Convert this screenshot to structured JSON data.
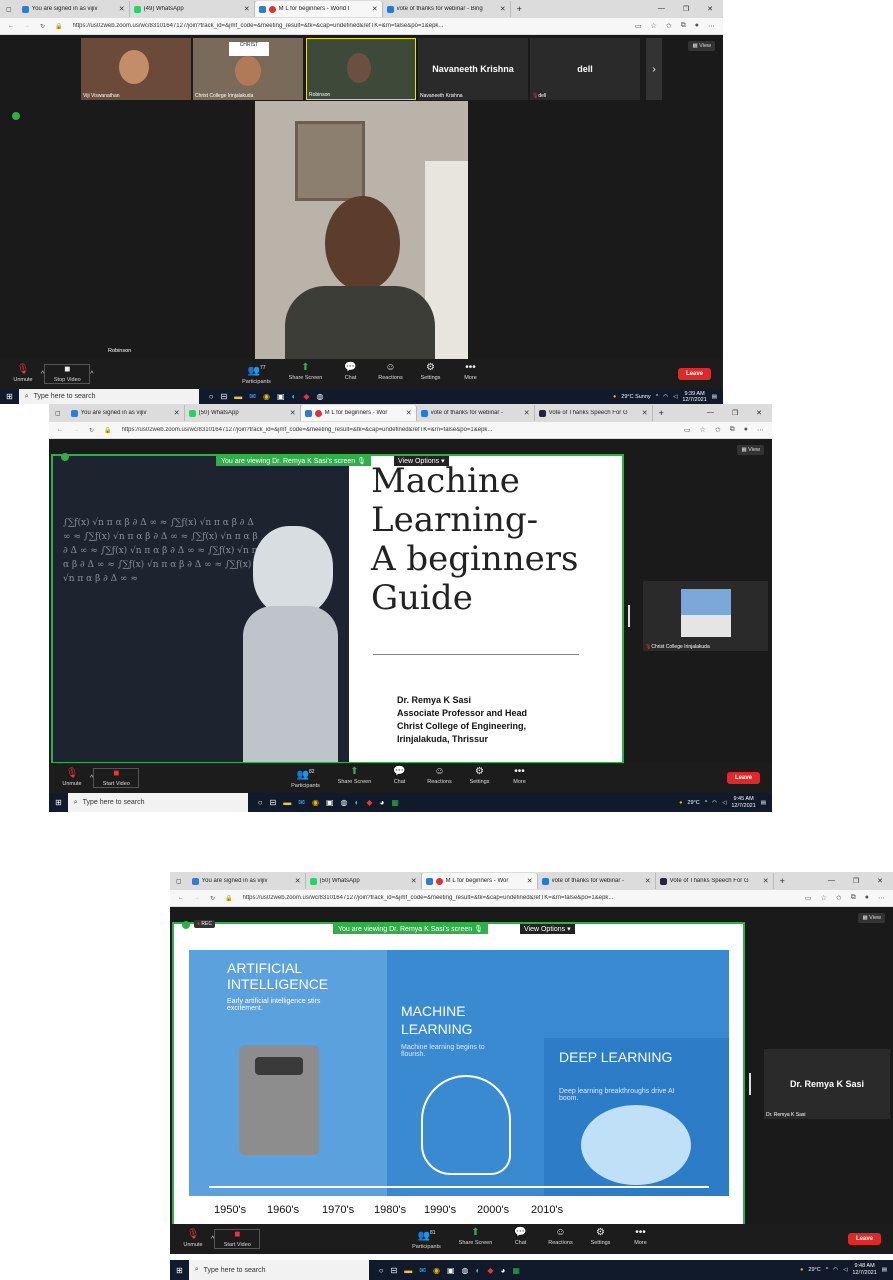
{
  "s1": {
    "tabs": [
      {
        "label": "You are signed in as vijiv",
        "color": "#2d7dd2",
        "active": false
      },
      {
        "label": "(49) WhatsApp",
        "color": "#25d366",
        "active": false
      },
      {
        "label": "M L for beginners - World I",
        "color": "#d33",
        "active": true
      },
      {
        "label": "vote of thanks for webinar - Bing",
        "color": "#1e7be0",
        "active": false
      }
    ],
    "url": "https://us02web.zoom.us/wc/83101647127/join?track_id=&jmf_code=&meeting_result=&tk=&cap=undefined&refTK=&rn=false&po=1&epk...",
    "thumbs": [
      "Viji Viswanathan",
      "Christ College Irinjalakuda",
      "Robinson",
      "Navaneeth Krishna",
      "dell"
    ],
    "speaker": "Robinson",
    "view": "View",
    "ctrl": {
      "unmute": "Unmute",
      "stop": "Stop Video",
      "participants": "Participants",
      "count": "77",
      "share": "Share Screen",
      "chat": "Chat",
      "reactions": "Reactions",
      "settings": "Settings",
      "more": "More",
      "leave": "Leave"
    },
    "search": "Type here to search",
    "weather": "29°C  Sunny",
    "time": "9:39 AM",
    "date": "12/7/2021"
  },
  "s2": {
    "tabs": [
      {
        "label": "You are signed in as vijiv",
        "color": "#2d7dd2",
        "active": false
      },
      {
        "label": "(50) WhatsApp",
        "color": "#25d366",
        "active": false
      },
      {
        "label": "M L for beginners - Wor",
        "color": "#d33",
        "active": true
      },
      {
        "label": "vote of thanks for webinar -",
        "color": "#1e7be0",
        "active": false
      },
      {
        "label": "Vote of Thanks Speech For G",
        "color": "#224",
        "active": false
      }
    ],
    "url": "https://us02web.zoom.us/wc/83101647127/join?track_id=&jmf_code=&meeting_result=&tk=&cap=undefined&refTK=&rn=false&po=1&epk...",
    "banner": "You are viewing Dr. Remya K Sasi's screen",
    "viewopt": "View Options",
    "view": "View",
    "title1": "Machine",
    "title2": "Learning-",
    "title3": "A beginners",
    "title4": "Guide",
    "author1": "Dr. Remya K Sasi",
    "author2": "Associate Professor and Head",
    "author3": "Christ College of Engineering,",
    "author4": "Irinjalakuda, Thrissur",
    "side": "Christ College Irinjalakuda",
    "ctrl": {
      "unmute": "Unmute",
      "stop": "Start Video",
      "participants": "Participants",
      "count": "82",
      "share": "Share Screen",
      "chat": "Chat",
      "reactions": "Reactions",
      "settings": "Settings",
      "more": "More",
      "leave": "Leave"
    },
    "search": "Type here to search",
    "weather": "29°C",
    "time": "9:45 AM",
    "date": "12/7/2021"
  },
  "s3": {
    "tabs": [
      {
        "label": "You are signed in as vijiv",
        "color": "#2d7dd2",
        "active": false
      },
      {
        "label": "(50) WhatsApp",
        "color": "#25d366",
        "active": false
      },
      {
        "label": "M L for beginners - Wor",
        "color": "#d33",
        "active": true
      },
      {
        "label": "vote of thanks for webinar -",
        "color": "#1e7be0",
        "active": false
      },
      {
        "label": "Vote of Thanks Speech For G",
        "color": "#224",
        "active": false
      }
    ],
    "url": "https://us02web.zoom.us/wc/83101647127/join?track_id=&jmf_code=&meeting_result=&tk=&cap=undefined&refTK=&rn=false&po=1&epk...",
    "banner": "You are viewing Dr. Remya K Sasi's screen",
    "viewopt": "View Options",
    "rec": "REC",
    "view": "View",
    "ai_title": "ARTIFICIAL INTELLIGENCE",
    "ai_sub": "Early artificial intelligence stirs excitement.",
    "ml_title": "MACHINE LEARNING",
    "ml_sub": "Machine learning begins to flourish.",
    "dl_title": "DEEP LEARNING",
    "dl_sub": "Deep learning breakthroughs drive AI boom.",
    "years": [
      "1950's",
      "1960's",
      "1970's",
      "1980's",
      "1990's",
      "2000's",
      "2010's"
    ],
    "side_big": "Dr. Remya K Sasi",
    "side": "Dr. Remya K Sasi",
    "ctrl": {
      "unmute": "Unmute",
      "stop": "Start Video",
      "participants": "Participants",
      "count": "81",
      "share": "Share Screen",
      "chat": "Chat",
      "reactions": "Reactions",
      "settings": "Settings",
      "more": "More",
      "leave": "Leave"
    },
    "search": "Type here to search",
    "weather": "29°C",
    "time": "9:48 AM",
    "date": "12/7/2021"
  }
}
